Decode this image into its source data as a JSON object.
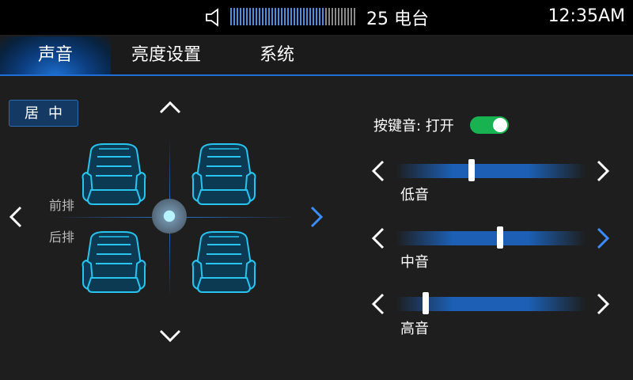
{
  "status": {
    "station": "25 电台",
    "time": "12:35AM",
    "volume_level": 0.75
  },
  "tabs": [
    {
      "label": "声音",
      "active": true
    },
    {
      "label": "亮度设置",
      "active": false
    },
    {
      "label": "系统",
      "active": false
    }
  ],
  "balance": {
    "center_button": "居中",
    "front_label": "前排",
    "rear_label": "后排"
  },
  "key_sound": {
    "label": "按键音: 打开",
    "enabled": true
  },
  "eq": [
    {
      "label": "低音",
      "level": 0.4
    },
    {
      "label": "中音",
      "level": 0.55
    },
    {
      "label": "高音",
      "level": 0.16
    }
  ],
  "colors": {
    "accent": "#1e6fd8",
    "seat_outline": "#28c3ee",
    "toggle_on": "#18b350"
  }
}
